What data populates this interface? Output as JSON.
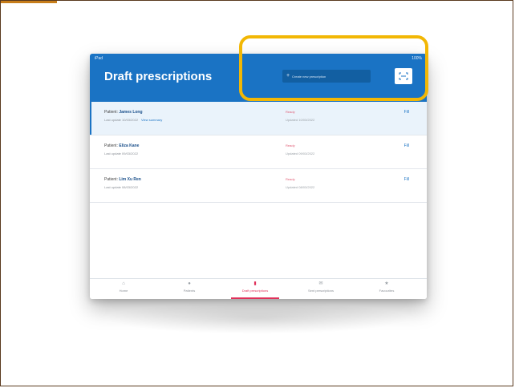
{
  "status_bar": {
    "left": "iPad",
    "right": "100%"
  },
  "header": {
    "title": "Draft prescriptions",
    "create_label": "Create new prescription",
    "scan_icon": "scan-icon"
  },
  "rows": [
    {
      "patient_label": "Patient:",
      "patient_name": "James Long",
      "meta": "Last update 10/03/2022",
      "link": "View summary",
      "status": "Ready",
      "action": "Fill",
      "status_detail": "Updated 10/03/2022",
      "selected": true
    },
    {
      "patient_label": "Patient:",
      "patient_name": "Eliza Kane",
      "meta": "Last update 09/03/2022",
      "link": "",
      "status": "Ready",
      "action": "Fill",
      "status_detail": "Updated 09/03/2022",
      "selected": false
    },
    {
      "patient_label": "Patient:",
      "patient_name": "Lim Xu Ren",
      "meta": "Last update 08/03/2022",
      "link": "",
      "status": "Ready",
      "action": "Fill",
      "status_detail": "Updated 08/03/2022",
      "selected": false
    }
  ],
  "tabs": [
    {
      "label": "Home",
      "icon": "home-icon"
    },
    {
      "label": "Patients",
      "icon": "person-icon"
    },
    {
      "label": "Draft prescriptions",
      "icon": "draft-icon",
      "active": true
    },
    {
      "label": "Sent prescriptions",
      "icon": "sent-icon"
    },
    {
      "label": "Favourites",
      "icon": "star-icon"
    }
  ],
  "colors": {
    "header_blue": "#1a73c4",
    "highlight": "#f2b705",
    "active_tab": "#e0315a"
  }
}
